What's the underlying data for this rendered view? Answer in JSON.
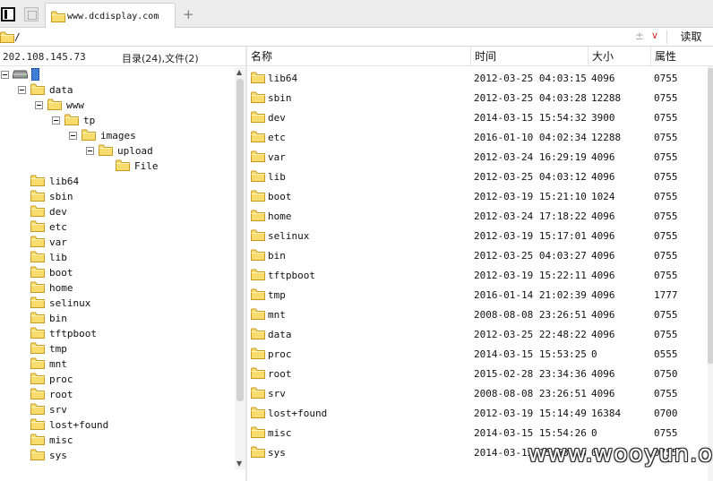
{
  "tab": {
    "title": "www.dcdisplay.com",
    "new_tab": "+"
  },
  "pathbar": {
    "path": "/",
    "plus": "±",
    "dropdown": "∨",
    "read_label": "读取"
  },
  "server": {
    "ip": "202.108.145.73",
    "summary": "目录(24),文件(2)"
  },
  "tree": {
    "data": "data",
    "www": "www",
    "tp": "tp",
    "images": "images",
    "upload": "upload",
    "file": "File",
    "dirs": [
      "lib64",
      "sbin",
      "dev",
      "etc",
      "var",
      "lib",
      "boot",
      "home",
      "selinux",
      "bin",
      "tftpboot",
      "tmp",
      "mnt",
      "proc",
      "root",
      "srv",
      "lost+found",
      "misc",
      "sys"
    ]
  },
  "columns": {
    "name": "名称",
    "time": "时间",
    "size": "大小",
    "attr": "属性"
  },
  "files": [
    {
      "name": "lib64",
      "time": "2012-03-25 04:03:15",
      "size": "4096",
      "attr": "0755"
    },
    {
      "name": "sbin",
      "time": "2012-03-25 04:03:28",
      "size": "12288",
      "attr": "0755"
    },
    {
      "name": "dev",
      "time": "2014-03-15 15:54:32",
      "size": "3900",
      "attr": "0755"
    },
    {
      "name": "etc",
      "time": "2016-01-10 04:02:34",
      "size": "12288",
      "attr": "0755"
    },
    {
      "name": "var",
      "time": "2012-03-24 16:29:19",
      "size": "4096",
      "attr": "0755"
    },
    {
      "name": "lib",
      "time": "2012-03-25 04:03:12",
      "size": "4096",
      "attr": "0755"
    },
    {
      "name": "boot",
      "time": "2012-03-19 15:21:10",
      "size": "1024",
      "attr": "0755"
    },
    {
      "name": "home",
      "time": "2012-03-24 17:18:22",
      "size": "4096",
      "attr": "0755"
    },
    {
      "name": "selinux",
      "time": "2012-03-19 15:17:01",
      "size": "4096",
      "attr": "0755"
    },
    {
      "name": "bin",
      "time": "2012-03-25 04:03:27",
      "size": "4096",
      "attr": "0755"
    },
    {
      "name": "tftpboot",
      "time": "2012-03-19 15:22:11",
      "size": "4096",
      "attr": "0755"
    },
    {
      "name": "tmp",
      "time": "2016-01-14 21:02:39",
      "size": "4096",
      "attr": "1777"
    },
    {
      "name": "mnt",
      "time": "2008-08-08 23:26:51",
      "size": "4096",
      "attr": "0755"
    },
    {
      "name": "data",
      "time": "2012-03-25 22:48:22",
      "size": "4096",
      "attr": "0755"
    },
    {
      "name": "proc",
      "time": "2014-03-15 15:53:25",
      "size": "0",
      "attr": "0555"
    },
    {
      "name": "root",
      "time": "2015-02-28 23:34:36",
      "size": "4096",
      "attr": "0750"
    },
    {
      "name": "srv",
      "time": "2008-08-08 23:26:51",
      "size": "4096",
      "attr": "0755"
    },
    {
      "name": "lost+found",
      "time": "2012-03-19 15:14:49",
      "size": "16384",
      "attr": "0700"
    },
    {
      "name": "misc",
      "time": "2014-03-15 15:54:26",
      "size": "0",
      "attr": "0755"
    },
    {
      "name": "sys",
      "time": "2014-03-15 15:53:26",
      "size": "0",
      "attr": "0755"
    }
  ],
  "watermark": "www.wooyun.org",
  "icons": {
    "folder": "folder-icon",
    "disk": "hard-disk-icon",
    "panel": "panel-toggle-icon",
    "expand": "minus-box-icon"
  },
  "colors": {
    "folder_fill": "#f9dc6e",
    "folder_stroke": "#c79a1f",
    "selection": "#3f7fd8",
    "dropdown": "#d22c2c"
  }
}
